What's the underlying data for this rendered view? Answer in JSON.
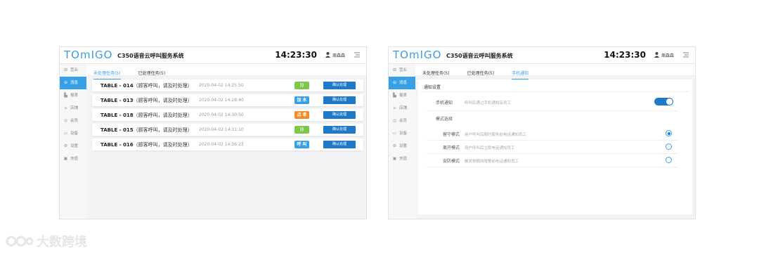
{
  "left_screen": {
    "logo": "TOmIGO",
    "app_title": "C350语音云呼叫服务系统",
    "clock": "14:23:30",
    "user_name": "周森森",
    "sidebar": [
      {
        "label": "营业",
        "icon": "grid-icon",
        "active": false
      },
      {
        "label": "消息",
        "icon": "message-icon",
        "active": true
      },
      {
        "label": "报表",
        "icon": "chart-icon",
        "active": false
      },
      {
        "label": "店铺",
        "icon": "store-icon",
        "active": false
      },
      {
        "label": "会员",
        "icon": "member-icon",
        "active": false
      },
      {
        "label": "设备",
        "icon": "device-icon",
        "active": false
      },
      {
        "label": "设置",
        "icon": "settings-icon",
        "active": false
      },
      {
        "label": "充值",
        "icon": "recharge-icon",
        "active": false
      }
    ],
    "tabs": [
      {
        "label": "未处理任务(5)",
        "active": true
      },
      {
        "label": "已处理任务(5)",
        "active": false
      }
    ],
    "tasks": [
      {
        "table": "TABLE - 014",
        "msg": "（顾客呼叫，请及时处理）",
        "time": "2020-04-02  14:25:50",
        "badge": "))",
        "badge_color": "green",
        "action": "确认处理"
      },
      {
        "table": "TABLE - 013",
        "msg": "（顾客呼叫，请及时处理）",
        "time": "2020-04-02  14:28:40",
        "badge": "加 水",
        "badge_color": "blue",
        "action": "确认处理"
      },
      {
        "table": "TABLE - 018",
        "msg": "（顾客呼叫，请及时处理）",
        "time": "2020-04-02  14:30:50",
        "badge": "点 单",
        "badge_color": "orange",
        "action": "确认处理"
      },
      {
        "table": "TABLE - 015",
        "msg": "（顾客呼叫，请及时处理）",
        "time": "2020-04-02  14:31:10",
        "badge": "))",
        "badge_color": "green",
        "action": "确认处理"
      },
      {
        "table": "TABLE - 016",
        "msg": "（顾客呼叫，请及时处理）",
        "time": "2020-04-02  14:36:23",
        "badge": "呼 叫",
        "badge_color": "blue",
        "action": "确认处理"
      }
    ]
  },
  "right_screen": {
    "logo": "TOmIGO",
    "app_title": "C350语音云呼叫服务系统",
    "clock": "14:23:30",
    "user_name": "周森森",
    "tabs": [
      {
        "label": "未处理任务(5)",
        "active": false
      },
      {
        "label": "已处理任务(5)",
        "active": false
      },
      {
        "label": "手机通知",
        "active": true
      }
    ],
    "section_title": "通知设置",
    "phone_notify": {
      "label": "手机通知",
      "desc": "呼叫后通过手机通知店员工",
      "enabled": true
    },
    "mode_title": "模式选择",
    "modes": [
      {
        "label": "留守模式",
        "desc": "用户呼叫后随时服务前电话通知员工",
        "selected": true
      },
      {
        "label": "离开模式",
        "desc": "用户呼叫后立即电话通知员工",
        "selected": false
      },
      {
        "label": "安防模式",
        "desc": "触发物联网报警前电话通知员工",
        "selected": false
      }
    ]
  },
  "watermark": "大数跨境",
  "colors": {
    "accent": "#3aa0e6",
    "button": "#1f79c9",
    "green": "#7cc94a",
    "orange": "#f28c28"
  }
}
